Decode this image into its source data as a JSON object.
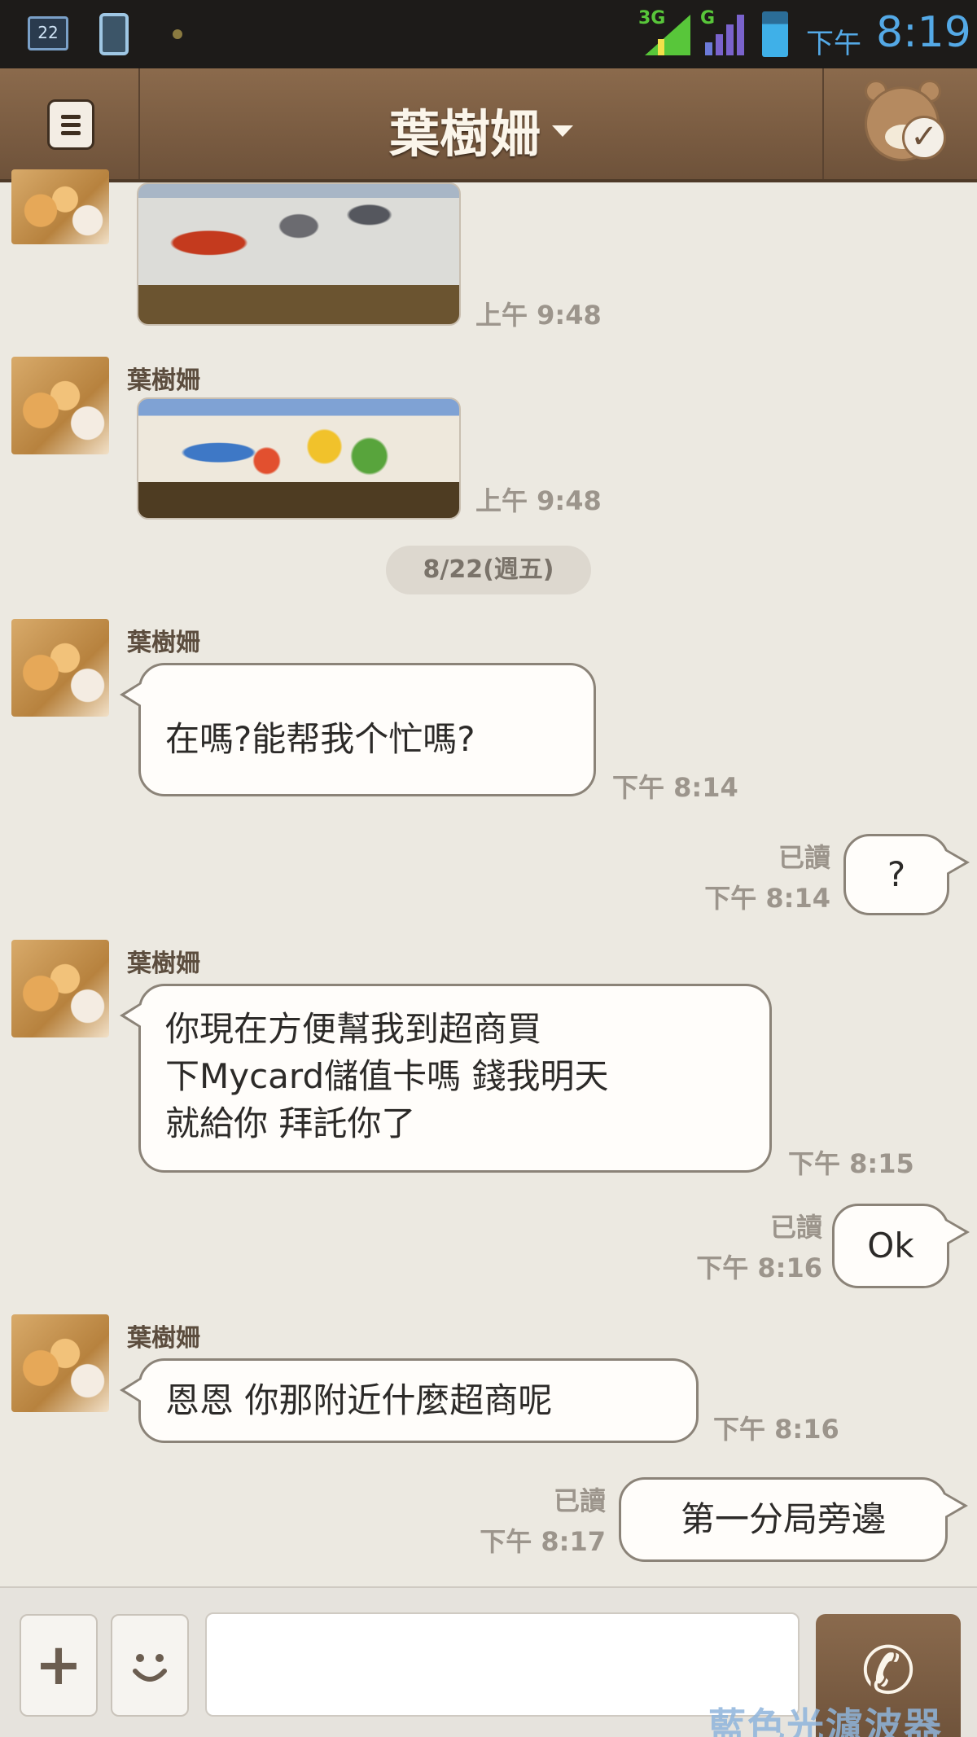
{
  "status_bar": {
    "calendar_day": "22",
    "network_1": "3G",
    "network_2": "G",
    "ampm": "下午",
    "time": "8:19",
    "icons": [
      "calendar-icon",
      "phone-icon",
      "notification-dot-icon",
      "signal-icon",
      "battery-icon"
    ]
  },
  "header": {
    "title": "葉樹姍",
    "icons": [
      "menu-icon",
      "dropdown-caret-icon",
      "bear-check-icon"
    ]
  },
  "chat": {
    "date_divider": "8/22(週五)",
    "messages": [
      {
        "type": "image",
        "direction": "in",
        "time": "上午 9:48"
      },
      {
        "type": "image",
        "direction": "in",
        "sender": "葉樹姍",
        "time": "上午 9:48"
      },
      {
        "type": "text",
        "direction": "in",
        "sender": "葉樹姍",
        "lines": [
          "",
          "在嗎?能帮我个忙嗎?"
        ],
        "time": "下午 8:14"
      },
      {
        "type": "text",
        "direction": "out",
        "lines": [
          "?"
        ],
        "read": "已讀",
        "time": "下午 8:14"
      },
      {
        "type": "text",
        "direction": "in",
        "sender": "葉樹姍",
        "lines": [
          "你現在方便幫我到超商買",
          "下Mycard儲值卡嗎 錢我明天",
          "就給你 拜託你了"
        ],
        "time": "下午 8:15"
      },
      {
        "type": "text",
        "direction": "out",
        "lines": [
          "Ok"
        ],
        "read": "已讀",
        "time": "下午 8:16"
      },
      {
        "type": "text",
        "direction": "in",
        "sender": "葉樹姍",
        "lines": [
          "恩恩 你那附近什麼超商呢"
        ],
        "time": "下午 8:16"
      },
      {
        "type": "text",
        "direction": "out",
        "lines": [
          "第一分局旁邊"
        ],
        "read": "已讀",
        "time": "下午 8:17"
      }
    ]
  },
  "input_bar": {
    "add_label": "+",
    "sticker_label": "◡",
    "message_value": "",
    "call_label": "✆"
  },
  "watermark": "藍色光濾波器"
}
